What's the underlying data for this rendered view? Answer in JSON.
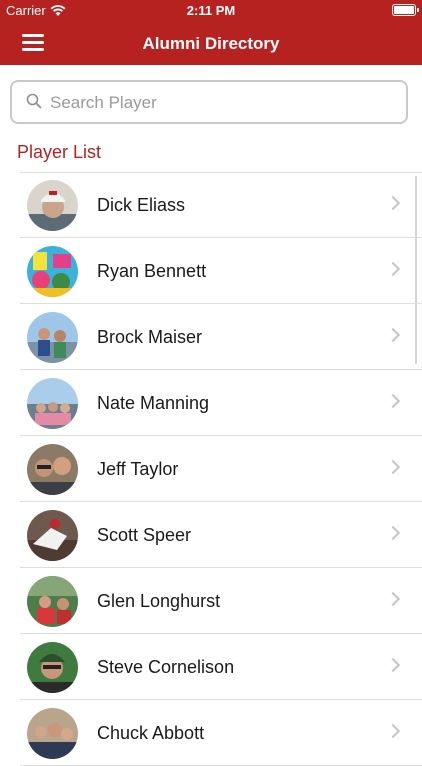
{
  "status_bar": {
    "carrier": "Carrier",
    "time": "2:11 PM"
  },
  "nav": {
    "title": "Alumni Directory"
  },
  "search": {
    "placeholder": "Search Player",
    "value": ""
  },
  "section_title": "Player List",
  "players": [
    {
      "name": "Dick Eliass"
    },
    {
      "name": "Ryan Bennett"
    },
    {
      "name": "Brock Maiser"
    },
    {
      "name": "Nate Manning"
    },
    {
      "name": "Jeff Taylor"
    },
    {
      "name": "Scott Speer"
    },
    {
      "name": "Glen Longhurst"
    },
    {
      "name": "Steve Cornelison"
    },
    {
      "name": "Chuck Abbott"
    }
  ],
  "colors": {
    "brand": "#b5221f",
    "divider": "#dedede"
  },
  "icons": {
    "menu": "hamburger-icon",
    "search": "search-icon",
    "chevron": "chevron-right-icon",
    "wifi": "wifi-icon",
    "battery": "battery-icon"
  }
}
